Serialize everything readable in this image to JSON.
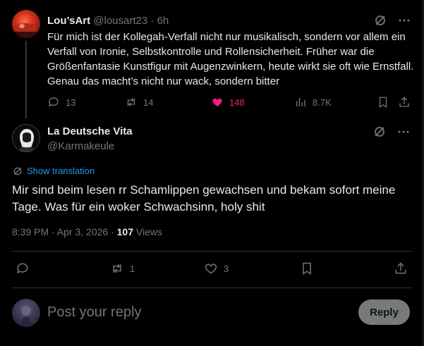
{
  "parent_tweet": {
    "display_name": "Lou’sArt",
    "handle": "@lousart23",
    "dot": "·",
    "time": "6h",
    "text": "Für mich ist der Kollegah-Verfall nicht nur musikalisch, sondern vor allem ein Verfall von Ironie, Selbstkontrolle und Rollensicherheit. Früher war die Größenfantasie Kunstfigur mit Augenzwinkern, heute wirkt sie oft wie Ernstfall. Genau das macht’s nicht nur wack, sondern bitter",
    "replies": "13",
    "reposts": "14",
    "likes": "148",
    "views": "8.7K",
    "like_color": "#f91880"
  },
  "main_tweet": {
    "display_name": "La Deutsche Vita",
    "handle": "@Karmakeule",
    "translate_label": "Show translation",
    "text": "Mir sind beim lesen rr Schamlippen gewachsen und bekam sofort meine Tage. Was für ein woker Schwachsinn, holy shit",
    "timestamp": "8:39 PM · Apr 3, 2026 ·",
    "views_count": "107",
    "views_label": "Views",
    "replies": "",
    "reposts": "1",
    "likes": "3"
  },
  "composer": {
    "placeholder": "Post your reply",
    "button_label": "Reply"
  },
  "colors": {
    "background": "#000000",
    "text": "#e7e9ea",
    "muted": "#71767b",
    "link": "#1d9bf0",
    "divider": "#2f3336"
  }
}
